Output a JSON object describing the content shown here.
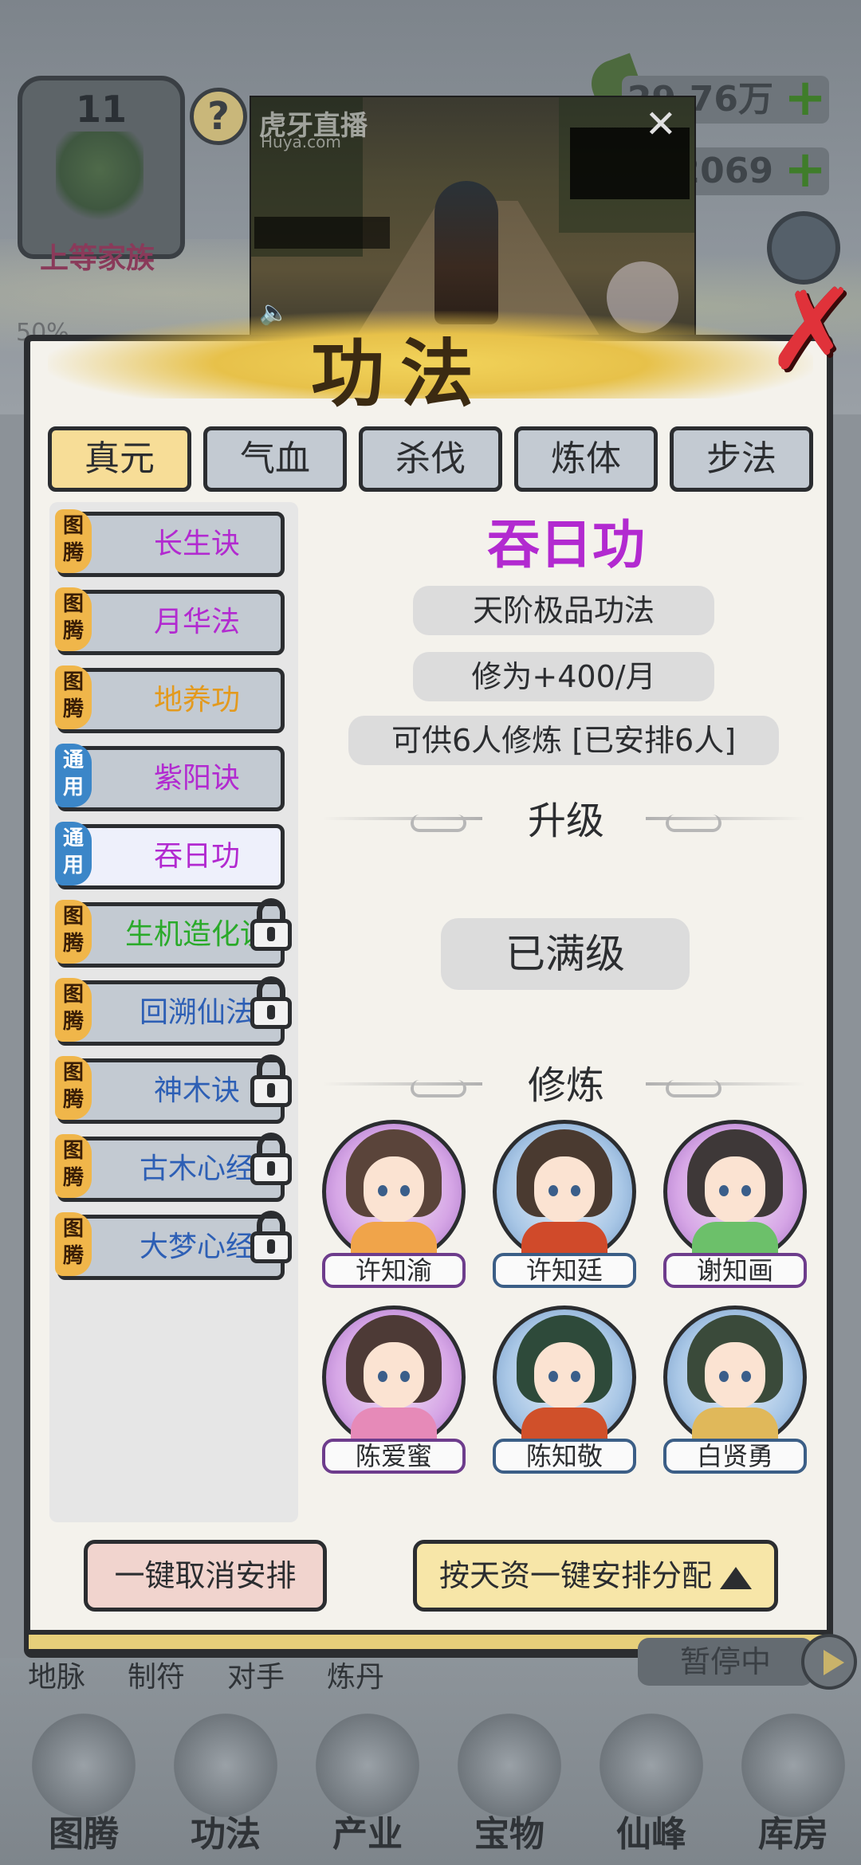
{
  "background": {
    "clan": {
      "level": "11",
      "title": "上等家族",
      "progress_text": "50%"
    },
    "help_label": "?",
    "resources": [
      {
        "value": "29.76万",
        "icon": "leaf-icon"
      },
      {
        "value": "2069",
        "icon": "coin-icon"
      }
    ],
    "plus_label": "+",
    "sub_nav": [
      "地脉",
      "制符",
      "对手",
      "炼丹"
    ],
    "paused_label": "暂停中",
    "bottom_nav": [
      "图腾",
      "功法",
      "产业",
      "宝物",
      "仙峰",
      "库房"
    ]
  },
  "video": {
    "logo": "虎牙直播",
    "logo_sub": "Huya.com",
    "close_label": "✕",
    "pin_label": "📌",
    "sound_label": "🔈"
  },
  "dialog": {
    "title": "功法",
    "close_label": "✗",
    "tabs": [
      {
        "label": "真元",
        "active": true
      },
      {
        "label": "气血",
        "active": false
      },
      {
        "label": "杀伐",
        "active": false
      },
      {
        "label": "炼体",
        "active": false
      },
      {
        "label": "步法",
        "active": false
      }
    ],
    "skills": [
      {
        "badge": "图腾",
        "badge_type": "totem",
        "name": "长生诀",
        "color": "#b22ad0",
        "locked": false,
        "selected": false
      },
      {
        "badge": "图腾",
        "badge_type": "totem",
        "name": "月华法",
        "color": "#b22ad0",
        "locked": false,
        "selected": false
      },
      {
        "badge": "图腾",
        "badge_type": "totem",
        "name": "地养功",
        "color": "#e39a1e",
        "locked": false,
        "selected": false
      },
      {
        "badge": "通用",
        "badge_type": "general",
        "name": "紫阳诀",
        "color": "#b22ad0",
        "locked": false,
        "selected": false
      },
      {
        "badge": "通用",
        "badge_type": "general",
        "name": "吞日功",
        "color": "#b22ad0",
        "locked": false,
        "selected": true
      },
      {
        "badge": "图腾",
        "badge_type": "totem",
        "name": "生机造化诀",
        "color": "#2aaa2a",
        "locked": true,
        "selected": false
      },
      {
        "badge": "图腾",
        "badge_type": "totem",
        "name": "回溯仙法",
        "color": "#2d5fb5",
        "locked": true,
        "selected": false
      },
      {
        "badge": "图腾",
        "badge_type": "totem",
        "name": "神木诀",
        "color": "#2d5fb5",
        "locked": true,
        "selected": false
      },
      {
        "badge": "图腾",
        "badge_type": "totem",
        "name": "古木心经",
        "color": "#2d5fb5",
        "locked": true,
        "selected": false
      },
      {
        "badge": "图腾",
        "badge_type": "totem",
        "name": "大梦心经",
        "color": "#2d5fb5",
        "locked": true,
        "selected": false
      }
    ],
    "detail": {
      "name": "吞日功",
      "grade": "天阶极品功法",
      "cultivation": "修为+400/月",
      "capacity": "可供6人修炼  [已安排6人]",
      "upgrade_heading": "升级",
      "max_level_label": "已满级",
      "practice_heading": "修炼",
      "practitioners": [
        {
          "name": "许知渝",
          "ring": "purple",
          "hair": "#5a443a",
          "robe": "#f0a44a"
        },
        {
          "name": "许知廷",
          "ring": "blue",
          "hair": "#4a3a30",
          "robe": "#d04a2a"
        },
        {
          "name": "谢知画",
          "ring": "purple",
          "hair": "#3e3838",
          "robe": "#6cc06a"
        },
        {
          "name": "陈爱蜜",
          "ring": "purple",
          "hair": "#4d3a36",
          "robe": "#e68ab8"
        },
        {
          "name": "陈知敬",
          "ring": "blue",
          "hair": "#2e4a3a",
          "robe": "#d0502a"
        },
        {
          "name": "白贤勇",
          "ring": "blue",
          "hair": "#3a4a3a",
          "robe": "#e0b85a"
        }
      ]
    },
    "cancel_all_label": "一键取消安排",
    "auto_assign_label": "按天资一键安排分配"
  }
}
